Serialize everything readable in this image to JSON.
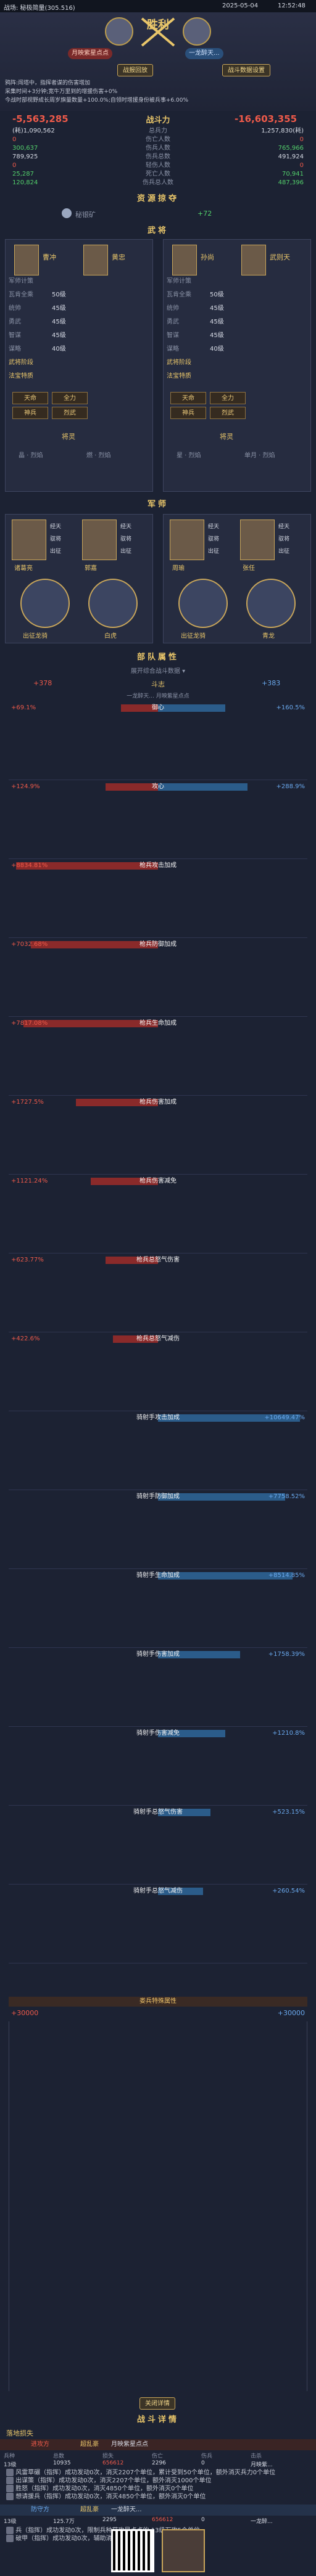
{
  "header": {
    "title": "战场: 秘极简量(305.516)",
    "date": "2025-05-04",
    "time": "12:52:48",
    "result": "胜利",
    "attacker_name": "月映紫星点点",
    "defender_name": "一龙醉天...",
    "attacker_level": "L",
    "defender_level": "L",
    "replay_btn": "战报回放",
    "stats_btn": "战斗数据设置",
    "buff_lines": [
      "鸦阵:闯塔中，指挥者谋的伤害增加",
      "采集时间+3分钟;宽牛万里到的增援伤害+0%",
      "今战时部视野成长周岁旗量数量+100.0%;自领时增援身份被兵事+6.00%"
    ]
  },
  "power": {
    "label": "战斗力",
    "left": "-5,563,285",
    "right": "-16,603,355",
    "rows": [
      {
        "l1": "(耗)1,090,562",
        "label": "总兵力",
        "r1": "1,257,830(耗)"
      },
      {
        "l1": "0",
        "label": "伤亡人数",
        "r1": "0"
      },
      {
        "l1": "300,637",
        "label": "伤兵人数",
        "r1": "765,966"
      },
      {
        "l1": "789,925",
        "label": "伤兵总数",
        "r1": "491,924"
      },
      {
        "l1": "0",
        "label": "轻伤人数",
        "r1": "0"
      },
      {
        "l1": "25,287",
        "label": "死亡人数",
        "r1": "70,941"
      },
      {
        "l1": "120,824",
        "label": "伤兵总人数",
        "r1": "487,396"
      }
    ]
  },
  "resource": {
    "title": "资源掠夺",
    "item": "秘银矿",
    "amount": "+72"
  },
  "generals": {
    "title": "武将",
    "left": [
      {
        "name": "曹冲",
        "star": "6"
      },
      {
        "name": "黄忠",
        "star": "6"
      }
    ],
    "right": [
      {
        "name": "孙尚",
        "star": "6"
      },
      {
        "name": "武则天",
        "star": "6"
      }
    ],
    "rows": [
      {
        "label": "军师计策",
        "v1": "",
        "v2": "军师计策",
        "v3": ""
      },
      {
        "label": "瓦肯全乘",
        "v1": "50级",
        "v2": "瓦肯全乘",
        "v3": "50级"
      },
      {
        "label": "统帅",
        "v1": "45级",
        "v2": "统帅",
        "v3": "45级"
      },
      {
        "label": "勇武",
        "v1": "45级",
        "v2": "勇武",
        "v3": "45级"
      },
      {
        "label": "智谋",
        "v1": "45级",
        "v2": "智谋",
        "v3": "45级"
      },
      {
        "label": "谋略",
        "v1": "40级",
        "v2": "谋略",
        "v3": "40级"
      },
      {
        "label": "武将阶段",
        "v1": "",
        "v2": "武将阶段",
        "v3": ""
      },
      {
        "label": "法宝特质",
        "v1": "",
        "v2": "法宝特质",
        "v3": ""
      }
    ],
    "skills_left": [
      "天命",
      "全力",
      "神兵",
      "烈武"
    ],
    "skills_right": [
      "天命",
      "全力",
      "神兵",
      "烈武"
    ],
    "spirit_left": "将灵",
    "spirit_right": "将灵",
    "spirit_names": [
      "晶 · 烈焰",
      "燃 · 烈焰",
      "星 · 烈焰",
      "单月 · 烈焰"
    ]
  },
  "advisors": {
    "title": "军师",
    "left": [
      {
        "name": "诸葛亮",
        "skills": [
          "经天",
          "驭将",
          "出征"
        ]
      },
      {
        "name": "郭嘉",
        "skills": [
          "经天",
          "驭将",
          "出征"
        ]
      }
    ],
    "right": [
      {
        "name": "周瑜",
        "skills": [
          "经天",
          "驭将",
          "出征"
        ]
      },
      {
        "name": "张任",
        "skills": [
          "经天",
          "驭将",
          "出征"
        ]
      }
    ],
    "bottom_left": [
      "出征龙骑",
      "白虎"
    ],
    "bottom_right": [
      "出征龙骑",
      "青龙"
    ]
  },
  "troops": {
    "title": "部队属性",
    "summary": "展开综合战斗数据",
    "left_score": "+378",
    "vs": "斗志",
    "right_score": "+383",
    "mini_note": "一龙醉天... 月映紫星点点",
    "bars": [
      {
        "l": "+69.1%",
        "label": "御心",
        "r": "+160.5%",
        "lw": 25,
        "rw": 45
      },
      {
        "l": "+124.9%",
        "label": "攻心",
        "r": "+288.9%",
        "lw": 35,
        "rw": 60
      },
      {
        "l": "+8834.81%",
        "label": "枪兵攻击加成",
        "r": "",
        "lw": 95,
        "rw": 0
      },
      {
        "l": "+7032.68%",
        "label": "枪兵防御加成",
        "r": "",
        "lw": 85,
        "rw": 0
      },
      {
        "l": "+7817.08%",
        "label": "枪兵生命加成",
        "r": "",
        "lw": 90,
        "rw": 0
      },
      {
        "l": "+1727.5%",
        "label": "枪兵伤害加成",
        "r": "",
        "lw": 55,
        "rw": 0
      },
      {
        "l": "+1121.24%",
        "label": "枪兵伤害减免",
        "r": "",
        "lw": 45,
        "rw": 0
      },
      {
        "l": "+623.77%",
        "label": "枪兵总怒气伤害",
        "r": "",
        "lw": 35,
        "rw": 0
      },
      {
        "l": "+422.6%",
        "label": "枪兵总怒气减伤",
        "r": "",
        "lw": 30,
        "rw": 0
      },
      {
        "l": "",
        "label": "骑射手攻击加成",
        "r": "+10649.47%",
        "lw": 0,
        "rw": 95
      },
      {
        "l": "",
        "label": "骑射手防御加成",
        "r": "+7758.52%",
        "lw": 0,
        "rw": 85
      },
      {
        "l": "",
        "label": "骑射手生命加成",
        "r": "+8514.85%",
        "lw": 0,
        "rw": 90
      },
      {
        "l": "",
        "label": "骑射手伤害加成",
        "r": "+1758.39%",
        "lw": 0,
        "rw": 55
      },
      {
        "l": "",
        "label": "骑射手伤害减免",
        "r": "+1210.8%",
        "lw": 0,
        "rw": 45
      },
      {
        "l": "",
        "label": "骑射手总怒气伤害",
        "r": "+523.15%",
        "lw": 0,
        "rw": 35
      },
      {
        "l": "",
        "label": "骑射手总怒气减伤",
        "r": "+260.54%",
        "lw": 0,
        "rw": 30
      }
    ],
    "special_title": "娄兵特殊属性",
    "special_left": "+30000",
    "special_right": "+30000"
  },
  "collapse_btn": "关闭详情",
  "details": {
    "title": "战斗详情",
    "sub": "落地损失",
    "attacker_label": "进攻方",
    "attacker_tag": "超乱豪",
    "attacker_name": "月映紫星点点",
    "defender_label": "防守方",
    "defender_tag": "超乱豪",
    "defender_name": "一龙醉天...",
    "columns": [
      "兵种",
      "总数",
      "损失",
      "伤亡",
      "伤兵",
      "击杀"
    ],
    "attacker_row": [
      "13级",
      "10935",
      "656612",
      "2296",
      "0",
      "月映紫..."
    ],
    "defender_row": [
      "13级",
      "125.7万",
      "2295",
      "656612",
      "0",
      "一龙醉..."
    ],
    "attacker_logs": [
      "风雷草碾（指挥）成功发动0次，消灭2207个单位，累计受到50个单位，额外消灭兵力0个单位",
      "出谋策（指挥）成功发动0次，消灭2207个单位，额外消灭1000个单位",
      "胜怒（指挥）成功发动0次，消灭4850个单位，额外消灭0个单位",
      "想请援兵（指挥）成功发动0次，消灭4850个单位，额外消灭0个单位"
    ],
    "defender_logs": [
      "兵（指挥）成功发动0次，限制兵种获攻星点点的 13级万攻5个单位",
      "破甲（指挥）成功发动0次，辅助消灭10个单位"
    ]
  },
  "colors": {
    "bg": "#1c2233",
    "gold": "#e9c66a",
    "red": "#ef5a4a",
    "blue": "#6aa9ee"
  },
  "icons": [
    "crossed-swords-icon",
    "shield-icon",
    "gear-icon",
    "chevron-down-icon",
    "qr-code-icon"
  ]
}
